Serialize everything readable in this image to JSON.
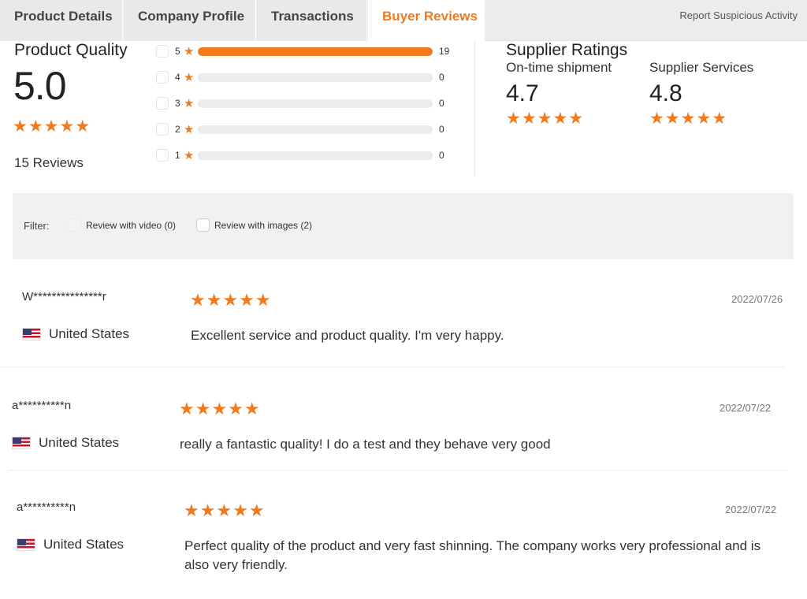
{
  "tabs": [
    {
      "label": "Product Details"
    },
    {
      "label": "Company Profile"
    },
    {
      "label": "Transactions"
    },
    {
      "label": "Buyer Reviews",
      "active": true
    }
  ],
  "report_link": "Report Suspicious Activity",
  "product_quality": {
    "title": "Product Quality",
    "score": "5.0",
    "stars": "★★★★★",
    "reviews_count": "15 Reviews"
  },
  "distribution": [
    {
      "label": "5",
      "count": "19",
      "fill_fraction": 1.0
    },
    {
      "label": "4",
      "count": "0",
      "fill_fraction": 0
    },
    {
      "label": "3",
      "count": "0",
      "fill_fraction": 0
    },
    {
      "label": "2",
      "count": "0",
      "fill_fraction": 0
    },
    {
      "label": "1",
      "count": "0",
      "fill_fraction": 0
    }
  ],
  "supplier_ratings": {
    "title": "Supplier Ratings",
    "items": [
      {
        "label": "On-time shipment",
        "score": "4.7",
        "stars": "★★★★★"
      },
      {
        "label": "Supplier Services",
        "score": "4.8",
        "stars": "★★★★★"
      }
    ]
  },
  "filter": {
    "label": "Filter:",
    "options": [
      {
        "label": "Review with video (0)"
      },
      {
        "label": "Review with images (2)"
      }
    ]
  },
  "reviews": [
    {
      "user": "W***************r",
      "stars": "★★★★★",
      "date": "2022/07/26",
      "country": "United States",
      "text": "Excellent service and product quality. I'm very happy."
    },
    {
      "user": "a**********n",
      "stars": "★★★★★",
      "date": "2022/07/22",
      "country": "United States",
      "text": "really a fantastic quality! I do a test and they behave very good"
    },
    {
      "user": "a**********n",
      "stars": "★★★★★",
      "date": "2022/07/22",
      "country": "United States",
      "text": "Perfect quality of the product and very fast shinning. The company works very professional and is also very friendly."
    }
  ],
  "colors": {
    "accent": "#f07a1e",
    "filter_bg": "#f1f1f1",
    "tab_bg": "#e9e9e9"
  },
  "icons": {
    "star": "star-icon",
    "flag": "us-flag-icon",
    "checkbox": "checkbox-icon"
  }
}
